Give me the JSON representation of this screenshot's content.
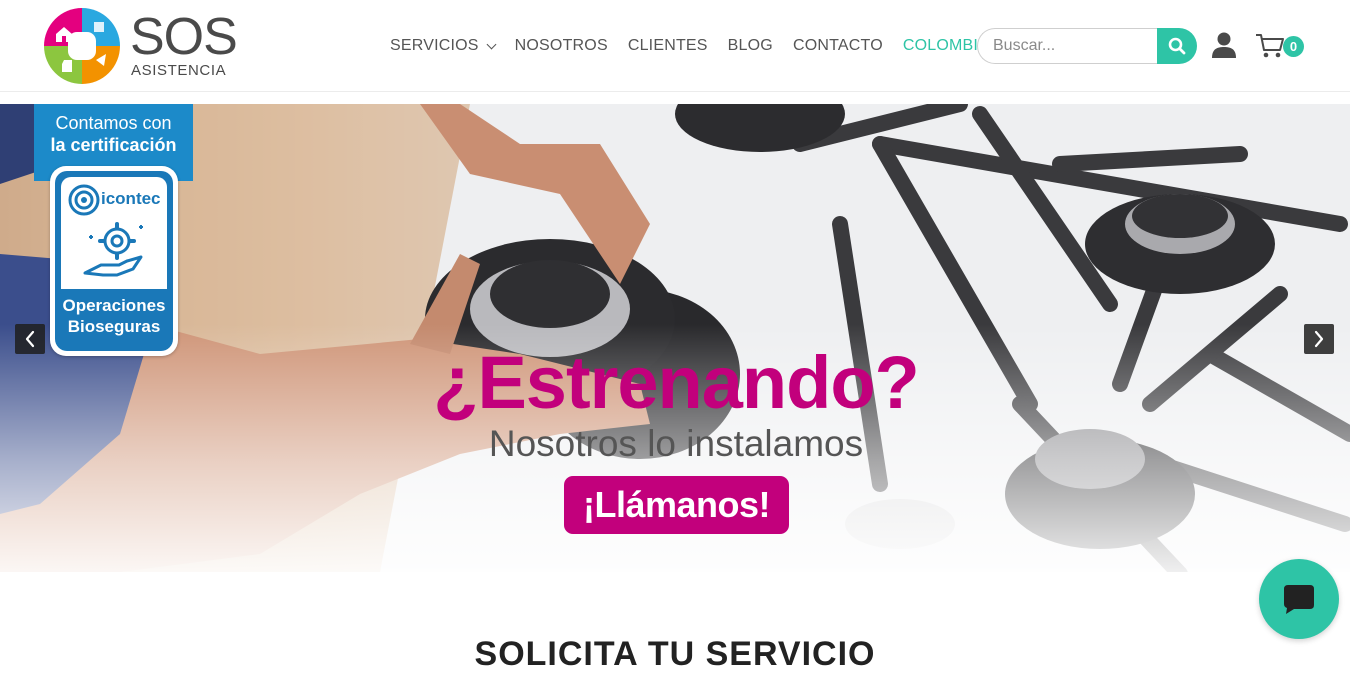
{
  "brand": {
    "name": "SOS",
    "tagline": "ASISTENCIA",
    "accent_color": "#2ec4a6",
    "magenta": "#c2007c"
  },
  "nav": {
    "items": [
      {
        "label": "SERVICIOS",
        "has_dropdown": true
      },
      {
        "label": "NOSOTROS",
        "has_dropdown": false
      },
      {
        "label": "CLIENTES",
        "has_dropdown": false
      },
      {
        "label": "BLOG",
        "has_dropdown": false
      },
      {
        "label": "CONTACTO",
        "has_dropdown": false
      },
      {
        "label": "COLOMBIA",
        "has_dropdown": true
      }
    ]
  },
  "search": {
    "placeholder": "Buscar...",
    "value": ""
  },
  "cart": {
    "count": "0"
  },
  "icons": {
    "search": "search-icon",
    "user": "user-icon",
    "cart": "cart-icon",
    "chat": "chat-icon",
    "prev": "chevron-left-icon",
    "next": "chevron-right-icon"
  },
  "hero": {
    "certification": {
      "line1": "Contamos con",
      "line2": "la certificación",
      "brand": "icontec",
      "line3": "Operaciones",
      "line4": "Bioseguras"
    },
    "title": "¿Estrenando?",
    "subtitle": "Nosotros lo instalamos",
    "cta": "¡Llámanos!"
  },
  "section": {
    "title": "SOLICITA TU SERVICIO"
  }
}
